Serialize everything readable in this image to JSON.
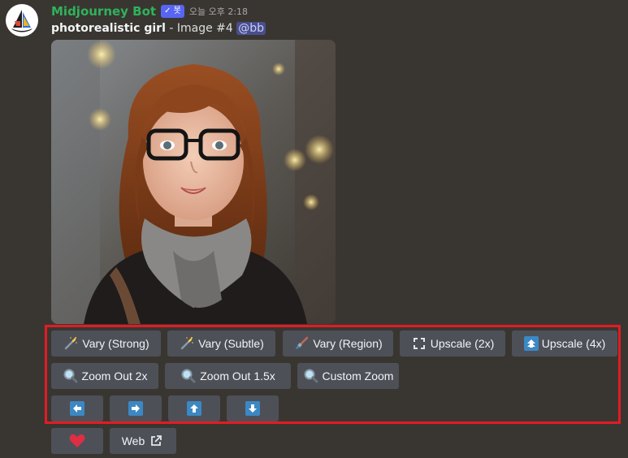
{
  "message": {
    "author": "Midjourney Bot",
    "badge": "✓ 봇",
    "timestamp": "오늘 오후 2:18",
    "prompt": "photorealistic girl",
    "image_label": " - Image #4 ",
    "mention": "@bb"
  },
  "buttons": {
    "row1": [
      {
        "label": "Vary (Strong)",
        "icon": "magic-wand-icon"
      },
      {
        "label": "Vary (Subtle)",
        "icon": "magic-wand-icon"
      },
      {
        "label": "Vary (Region)",
        "icon": "paintbrush-icon"
      },
      {
        "label": "Upscale (2x)",
        "icon": "expand-icon"
      },
      {
        "label": "Upscale (4x)",
        "icon": "up-arrow-box-icon"
      }
    ],
    "row2": [
      {
        "label": "Zoom Out 2x",
        "icon": "magnifier-icon"
      },
      {
        "label": "Zoom Out 1.5x",
        "icon": "magnifier-icon"
      },
      {
        "label": "Custom Zoom",
        "icon": "magnifier-icon"
      }
    ],
    "pan": [
      "left-arrow-icon",
      "right-arrow-icon",
      "up-arrow-icon",
      "down-arrow-icon"
    ],
    "favorite_icon": "heart-icon",
    "web_label": "Web",
    "web_icon": "external-link-icon"
  },
  "colors": {
    "background": "#393631",
    "author": "#2fb35c",
    "badge": "#5865f2",
    "button": "#4e5058",
    "highlight": "#e31b23",
    "heart": "#dd2e44",
    "arrow": "#3b88c3"
  }
}
